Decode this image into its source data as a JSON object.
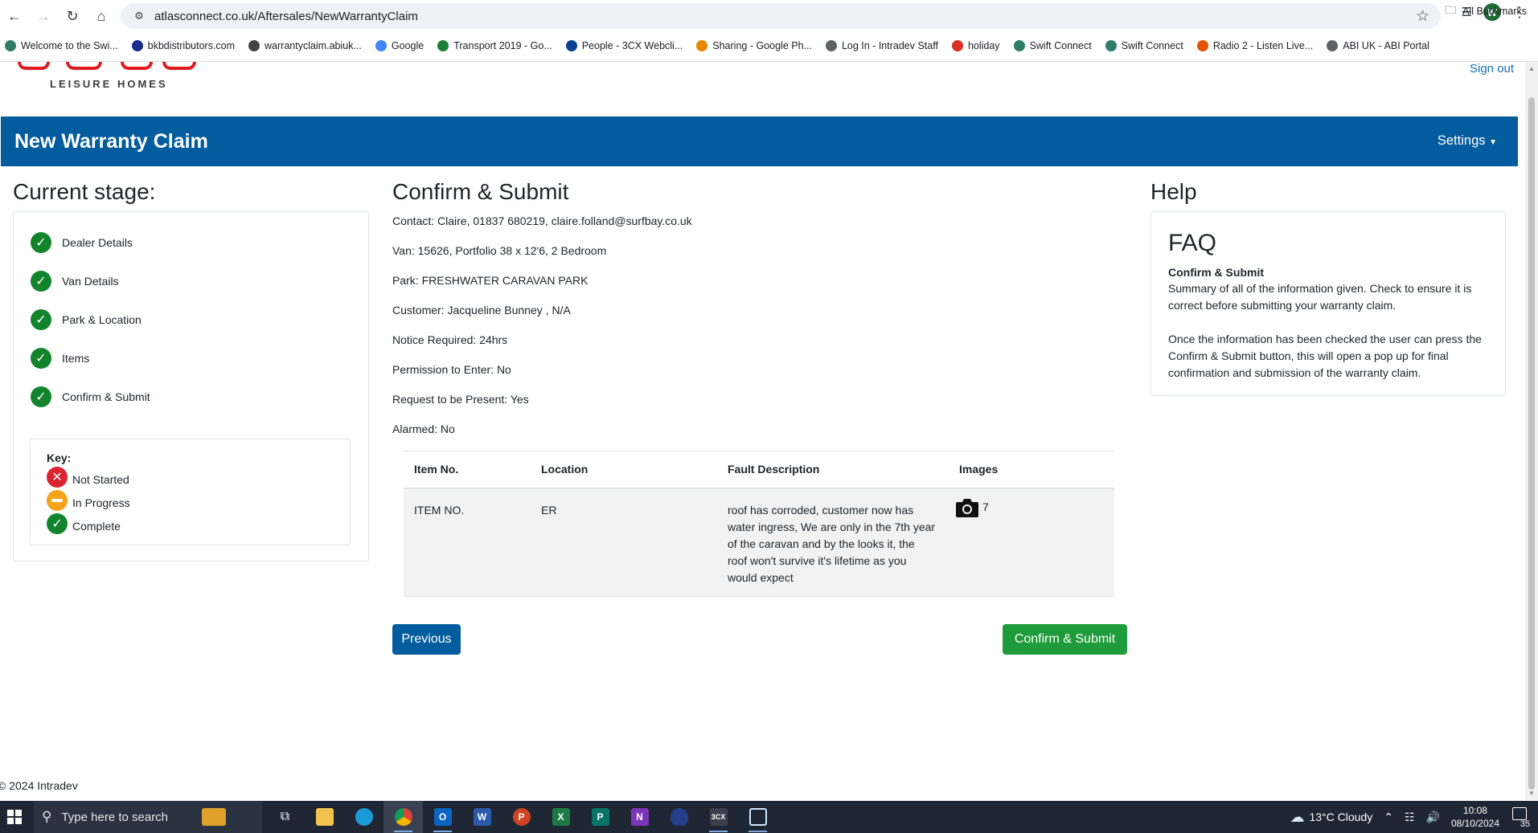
{
  "browser": {
    "url": "atlasconnect.co.uk/Aftersales/NewWarrantyClaim",
    "avatar_letter": "W",
    "bookmarks": [
      {
        "label": "Welcome to the Swi...",
        "icon": "swift-icon",
        "color": "#2e7d6b"
      },
      {
        "label": "bkbdistributors.com",
        "icon": "bkb-icon",
        "color": "#1a2b8a"
      },
      {
        "label": "warrantyclaim.abiuk...",
        "icon": "globe-icon",
        "color": "#444444"
      },
      {
        "label": "Google",
        "icon": "google-icon",
        "color": "#4285f4"
      },
      {
        "label": "Transport 2019 - Go...",
        "icon": "sheets-icon",
        "color": "#188038"
      },
      {
        "label": "People - 3CX Webcli...",
        "icon": "3cx-icon",
        "color": "#0b3d91"
      },
      {
        "label": "Sharing - Google Ph...",
        "icon": "photos-icon",
        "color": "#ea8600"
      },
      {
        "label": "Log In - Intradev Staff",
        "icon": "page-icon",
        "color": "#5f6368"
      },
      {
        "label": "holiday",
        "icon": "opera-icon",
        "color": "#d93025"
      },
      {
        "label": "Swift Connect",
        "icon": "swift-icon",
        "color": "#2e7d6b"
      },
      {
        "label": "Swift Connect",
        "icon": "swift-icon",
        "color": "#2e7d6b"
      },
      {
        "label": "Radio 2 - Listen Live...",
        "icon": "radio-icon",
        "color": "#e65100"
      },
      {
        "label": "ABI UK - ABI Portal",
        "icon": "page-icon",
        "color": "#5f6368"
      }
    ],
    "all_bookmarks": "All Bookmarks"
  },
  "site": {
    "logo_tagline": "LEISURE HOMES",
    "sign_out": "Sign out",
    "header_title": "New Warranty Claim",
    "settings_label": "Settings"
  },
  "stage": {
    "title": "Current stage:",
    "items": [
      "Dealer Details",
      "Van Details",
      "Park & Location",
      "Items",
      "Confirm & Submit"
    ],
    "key_title": "Key:",
    "key": {
      "not_started": "Not Started",
      "in_progress": "In Progress",
      "complete": "Complete"
    }
  },
  "summary": {
    "title": "Confirm & Submit",
    "lines": [
      "Contact: Claire, 01837 680219, claire.folland@surfbay.co.uk",
      "Van: 15626, Portfolio 38 x 12'6, 2 Bedroom",
      "Park: FRESHWATER CARAVAN PARK",
      "Customer: Jacqueline Bunney , N/A",
      "Notice Required: 24hrs",
      "Permission to Enter: No",
      "Request to be Present: Yes",
      "Alarmed: No"
    ],
    "table": {
      "headers": [
        "Item No.",
        "Location",
        "Fault Description",
        "Images"
      ],
      "rows": [
        {
          "item_no": "ITEM NO.",
          "location": "ER",
          "fault": "roof has corroded, customer now has water ingress, We are only in the 7th year of the caravan and by the looks it, the roof won't survive it's lifetime as you would expect",
          "images": "7"
        }
      ]
    },
    "previous_label": "Previous",
    "submit_label": "Confirm & Submit"
  },
  "help": {
    "title": "Help",
    "faq_title": "FAQ",
    "faq_subtitle": "Confirm & Submit",
    "p1": "Summary of all of the information given. Check to ensure it is correct before submitting your warranty claim.",
    "p2": "Once the information has been checked the user can press the Confirm & Submit button, this will open a pop up for final confirmation and submission of the warranty claim."
  },
  "footer": "© 2024 Intradev",
  "taskbar": {
    "search_placeholder": "Type here to search",
    "weather": "13°C  Cloudy",
    "time": "10:08",
    "date": "08/10/2024",
    "notifications": "35"
  },
  "colors": {
    "brand_blue": "#035c9d",
    "success_green": "#1e9b3b",
    "complete_green": "#12852c",
    "error_red": "#dc2430",
    "progress_amber": "#f5a31a"
  }
}
